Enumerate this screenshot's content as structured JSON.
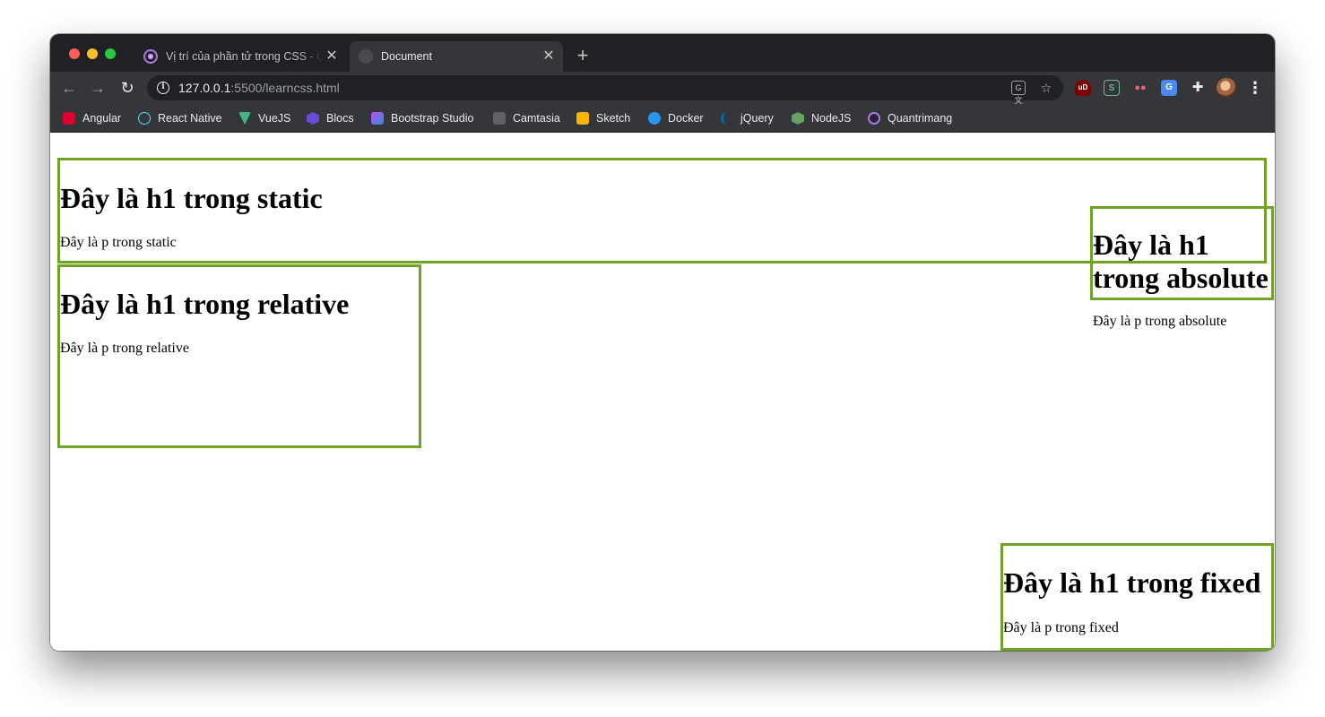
{
  "browser": {
    "tabs": [
      {
        "title": "Vị trí của phần tử trong CSS - Quantrimang.com",
        "favicon": "quantrimang-icon",
        "active": false
      },
      {
        "title": "Document",
        "favicon": "globe-icon",
        "active": true
      }
    ],
    "new_tab_symbol": "+",
    "url": {
      "host": "127.0.0.1",
      "rest": ":5500/learncss.html"
    },
    "bookmarks": [
      {
        "label": "Angular",
        "icon": "angular-icon",
        "color": "#dd0031"
      },
      {
        "label": "React Native",
        "icon": "react-icon",
        "color": "#61dafb"
      },
      {
        "label": "VueJS",
        "icon": "vue-icon",
        "color": "#41b883"
      },
      {
        "label": "Blocs",
        "icon": "blocs-icon",
        "color": "#6a4bd8"
      },
      {
        "label": "Bootstrap Studio",
        "icon": "bootstrap-studio-icon",
        "color": "#2b8fd6"
      },
      {
        "label": "Camtasia",
        "icon": "camtasia-icon",
        "color": "#5f6368"
      },
      {
        "label": "Sketch",
        "icon": "sketch-icon",
        "color": "#f7b500"
      },
      {
        "label": "Docker",
        "icon": "docker-icon",
        "color": "#2496ed"
      },
      {
        "label": "jQuery",
        "icon": "jquery-icon",
        "color": "#0769ad"
      },
      {
        "label": "NodeJS",
        "icon": "nodejs-icon",
        "color": "#68a063"
      },
      {
        "label": "Quantrimang",
        "icon": "quantrimang-icon",
        "color": "#a87ad9"
      }
    ],
    "extensions": [
      {
        "name": "ublock-icon",
        "glyph": "uD"
      },
      {
        "name": "s-extension-icon",
        "glyph": "S"
      },
      {
        "name": "eyes-extension-icon",
        "glyph": "👀"
      },
      {
        "name": "google-translate-icon",
        "glyph": "G"
      },
      {
        "name": "puzzle-icon",
        "glyph": "✚"
      }
    ]
  },
  "page": {
    "static": {
      "h1": "Đây là h1 trong static",
      "p": "Đây là p trong static"
    },
    "relative": {
      "h1": "Đây là h1 trong relative",
      "p": "Đây là p trong relative"
    },
    "absolute": {
      "h1": "Đây là h1 trong absolute",
      "p": "Đây là p trong absolute"
    },
    "fixed": {
      "h1": "Đây là h1 trong fixed",
      "p": "Đây là p trong fixed"
    },
    "border_color": "#6fa226"
  }
}
